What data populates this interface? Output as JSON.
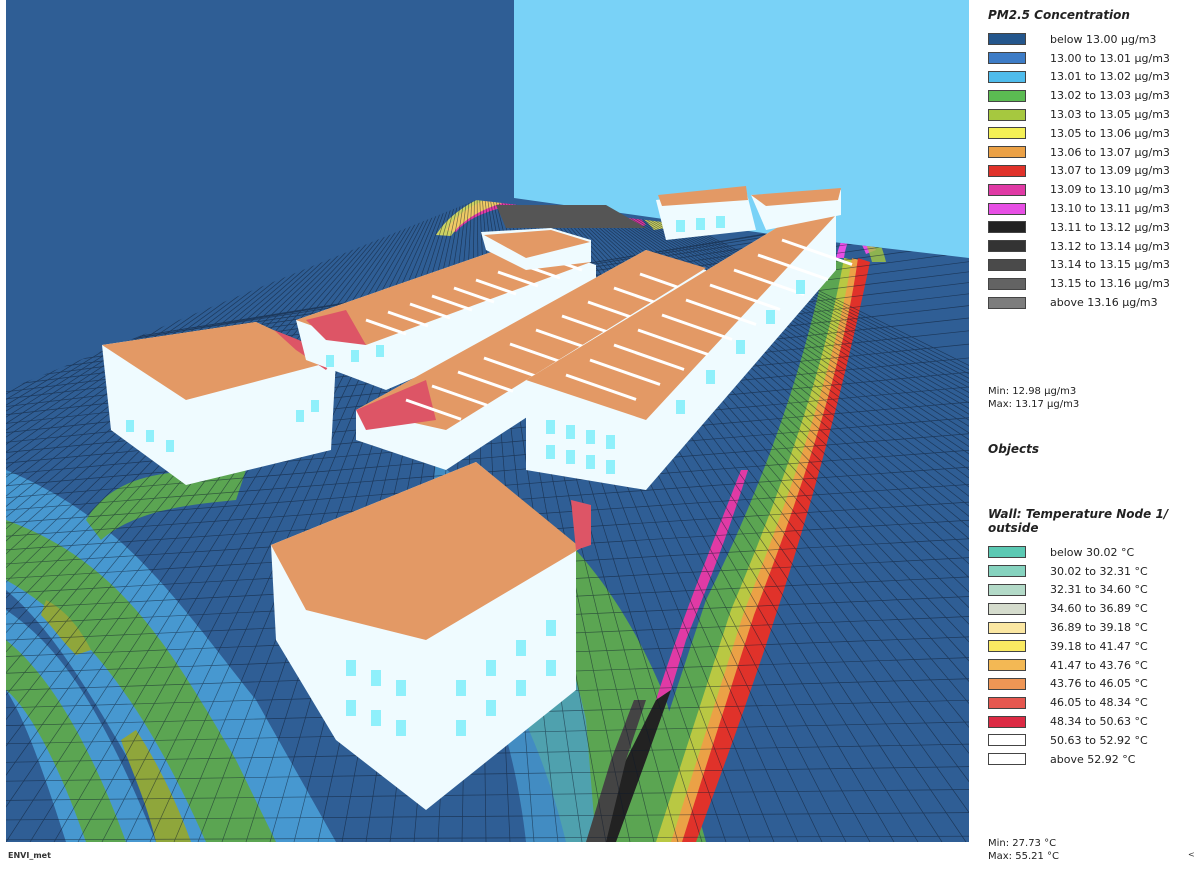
{
  "footer": {
    "label": "ENVI_met"
  },
  "scene": {
    "colors": {
      "back_wall": "#2f5e95",
      "side_wall": "#79d2f7",
      "ground_base": "#2f5e95",
      "roof": "#e39965",
      "roof_hot": "#dd5566",
      "facade": "#effbff",
      "window": "#8ff0fb"
    }
  },
  "legend": {
    "pm25": {
      "title": "PM2.5 Concentration",
      "items": [
        {
          "label": "below 13.00 µg/m3",
          "color": "#24568c"
        },
        {
          "label": "13.00 to 13.01 µg/m3",
          "color": "#3d7cc6"
        },
        {
          "label": "13.01 to 13.02 µg/m3",
          "color": "#4fbcec"
        },
        {
          "label": "13.02 to 13.03 µg/m3",
          "color": "#5bbb52"
        },
        {
          "label": "13.03 to 13.05 µg/m3",
          "color": "#a6c83f"
        },
        {
          "label": "13.05 to 13.06 µg/m3",
          "color": "#f4f055"
        },
        {
          "label": "13.06 to 13.07 µg/m3",
          "color": "#eba146"
        },
        {
          "label": "13.07 to 13.09 µg/m3",
          "color": "#e0322a"
        },
        {
          "label": "13.09 to 13.10 µg/m3",
          "color": "#e03aa5"
        },
        {
          "label": "13.10 to 13.11 µg/m3",
          "color": "#e74fe4"
        },
        {
          "label": "13.11 to 13.12 µg/m3",
          "color": "#222222"
        },
        {
          "label": "13.12 to 13.14 µg/m3",
          "color": "#333333"
        },
        {
          "label": "13.14 to 13.15 µg/m3",
          "color": "#4a4a4a"
        },
        {
          "label": "13.15 to 13.16 µg/m3",
          "color": "#636363"
        },
        {
          "label": "above 13.16 µg/m3",
          "color": "#7d7d7d"
        }
      ],
      "min": "Min: 12.98 µg/m3",
      "max": "Max: 13.17 µg/m3"
    },
    "objects_title": "Objects",
    "wall": {
      "title_line1": "Wall: Temperature Node 1/",
      "title_line2": "outside",
      "items": [
        {
          "label": "below 30.02 °C",
          "color": "#5bc9b3"
        },
        {
          "label": "30.02 to 32.31 °C",
          "color": "#86d3bf"
        },
        {
          "label": "32.31 to 34.60 °C",
          "color": "#b3dac8"
        },
        {
          "label": "34.60 to 36.89 °C",
          "color": "#d5dccd"
        },
        {
          "label": "36.89 to 39.18 °C",
          "color": "#fbe7a2"
        },
        {
          "label": "39.18 to 41.47 °C",
          "color": "#faea62"
        },
        {
          "label": "41.47 to 43.76 °C",
          "color": "#f3b854"
        },
        {
          "label": "43.76 to 46.05 °C",
          "color": "#ef9655"
        },
        {
          "label": "46.05 to 48.34 °C",
          "color": "#e6574f"
        },
        {
          "label": "48.34 to 50.63 °C",
          "color": "#dc2a44"
        },
        {
          "label": "50.63 to 52.92 °C",
          "color": "#ffffff"
        },
        {
          "label": "above 52.92 °C",
          "color": "#ffffff"
        }
      ],
      "min": "Min: 27.73 °C",
      "max": "Max: 55.21 °C"
    },
    "corner_marker": "<"
  }
}
